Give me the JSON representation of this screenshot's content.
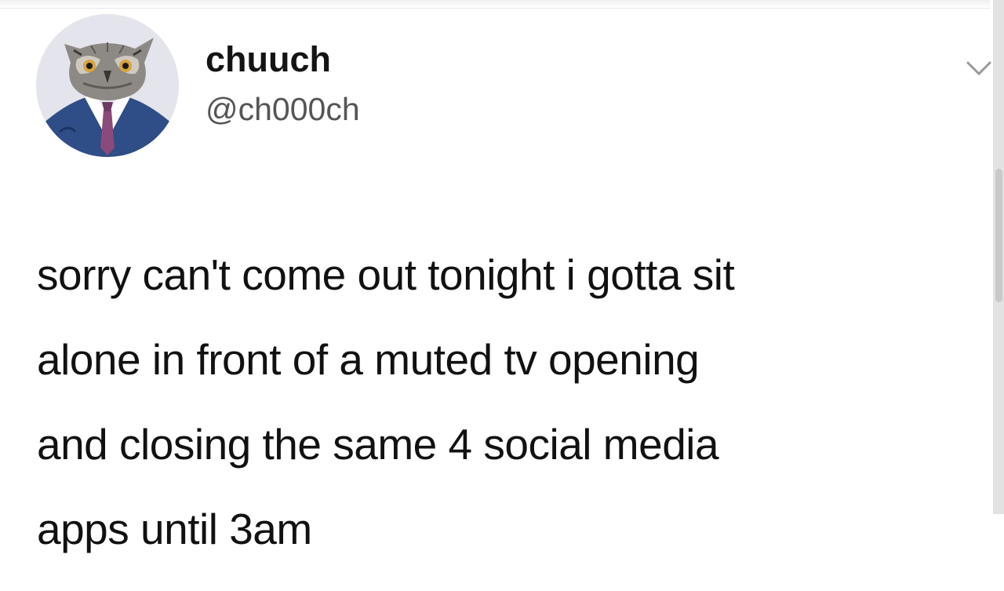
{
  "tweet": {
    "author": {
      "display_name": "chuuch",
      "handle": "@ch000ch",
      "avatar_icon": "owl-in-suit-avatar"
    },
    "menu_icon": "chevron-down-icon",
    "text_lines": [
      "sorry can't come out tonight i gotta sit",
      "alone in front of a muted tv opening",
      "and closing the same 4 social media",
      "apps until 3am"
    ]
  },
  "colors": {
    "background": "#ffffff",
    "text": "#111111",
    "handle": "#555555",
    "avatar_bg": "#e4e4ec",
    "suit": "#2f4d86"
  }
}
